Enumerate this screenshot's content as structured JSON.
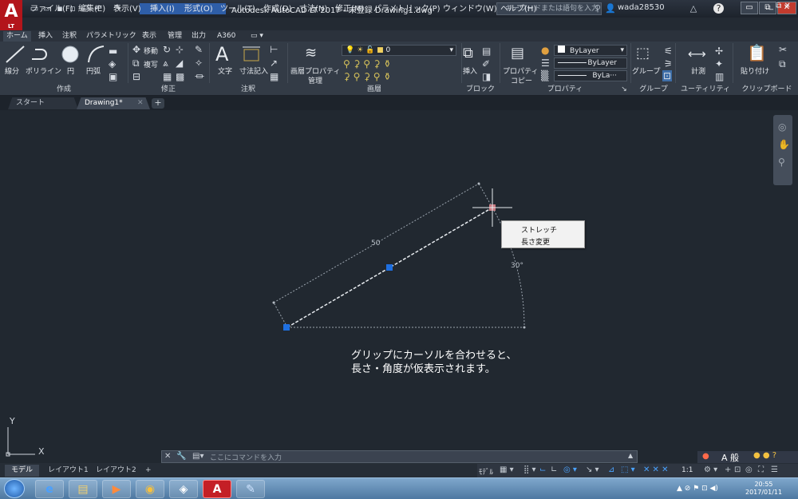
{
  "app": {
    "logo": "A",
    "logo_sub": "LT",
    "title": "Autodesk AutoCAD LT 2017 - 未登録    Drawing1.dwg",
    "search_placeholder": "キーワードまたは語句を入力",
    "user": "wada28530"
  },
  "menu": [
    "ファイル(F)",
    "編集(E)",
    "表示(V)",
    "挿入(I)",
    "形式(O)",
    "ツール(T)",
    "作成(D)",
    "寸法(N)",
    "修正(M)",
    "パラメトリック(P)",
    "ウィンドウ(W)",
    "ヘルプ(H)"
  ],
  "ribbon_tabs": [
    "ホーム",
    "挿入",
    "注釈",
    "パラメトリック",
    "表示",
    "管理",
    "出力",
    "A360"
  ],
  "ribbon": {
    "draw": {
      "line": "線分",
      "polyline": "ポリライン",
      "circle": "円",
      "arc": "円弧",
      "group": "作成"
    },
    "modify": {
      "move": "移動",
      "copy": "複写",
      "group": "修正"
    },
    "annotation": {
      "text": "文字",
      "dimension": "寸法記入",
      "group": "注釈"
    },
    "layers": {
      "props": "画層プロパティ",
      "manage": "管理",
      "current": "0",
      "group": "画層"
    },
    "block": {
      "insert": "挿入",
      "group": "ブロック"
    },
    "properties": {
      "match": "プロパティ",
      "copy": "コピー",
      "color": "ByLayer",
      "linetype": "ByLayer",
      "lineweight": "ByLa···",
      "group": "プロパティ"
    },
    "groups": {
      "group": "グループ",
      "group_label": "グループ"
    },
    "utilities": {
      "measure": "計測",
      "group": "ユーティリティ"
    },
    "clipboard": {
      "paste": "貼り付け",
      "group": "クリップボード"
    }
  },
  "file_tabs": [
    "スタート",
    "Drawing1*"
  ],
  "drawing": {
    "dim_length": "50",
    "dim_angle": "30°",
    "ucs_x": "X",
    "ucs_y": "Y",
    "caption_line1": "グリップにカーソルを合わせると、",
    "caption_line2": "長さ・角度が仮表示されます。"
  },
  "context_menu": [
    "ストレッチ",
    "長さ変更"
  ],
  "command": {
    "placeholder": "ここにコマンドを入力"
  },
  "layout_tabs": [
    "モデル",
    "レイアウト1",
    "レイアウト2"
  ],
  "status": {
    "model": "ﾓﾃﾞﾙ",
    "scale": "1:1"
  },
  "clock": {
    "time": "20:55",
    "date": "2017/01/11"
  }
}
